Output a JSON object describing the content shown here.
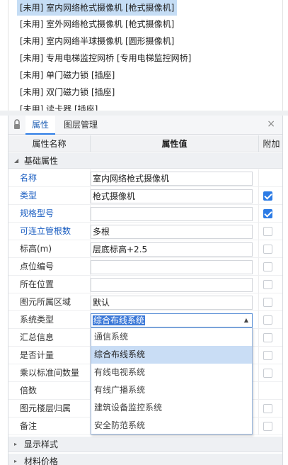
{
  "device_list": {
    "items": [
      {
        "label": "[未用] 室内网络枪式摄像机 [枪式摄像机]",
        "selected": true
      },
      {
        "label": "[未用] 室外网络枪式摄像机 [枪式摄像机]",
        "selected": false
      },
      {
        "label": "[未用] 室内网络半球摄像机 [圆形摄像机]",
        "selected": false
      },
      {
        "label": "[未用] 专用电梯监控网桥 [专用电梯监控网桥]",
        "selected": false
      },
      {
        "label": "[未用] 单门磁力锁 [插座]",
        "selected": false
      },
      {
        "label": "[未用] 双门磁力锁 [插座]",
        "selected": false
      },
      {
        "label": "[未用] 读卡器 [插座]",
        "selected": false
      }
    ]
  },
  "panel": {
    "tabs": [
      {
        "label": "属性",
        "active": true
      },
      {
        "label": "图层管理",
        "active": false
      }
    ],
    "close_symbol": "×",
    "columns": {
      "name": "属性名称",
      "value": "属性值",
      "extra": "附加"
    },
    "groups": {
      "basic": "基础属性",
      "display": "显示样式",
      "material": "材料价格"
    },
    "rows": [
      {
        "name": "名称",
        "value": "室内网络枪式摄像机",
        "blue": true,
        "checkbox": false,
        "has_checkbox": false
      },
      {
        "name": "类型",
        "value": "枪式摄像机",
        "blue": true,
        "checkbox": true,
        "has_checkbox": true
      },
      {
        "name": "规格型号",
        "value": "",
        "blue": true,
        "checkbox": true,
        "has_checkbox": true
      },
      {
        "name": "可连立管根数",
        "value": "多根",
        "blue": true,
        "checkbox": false,
        "has_checkbox": true
      },
      {
        "name": "标高(m)",
        "value": "层底标高+2.5",
        "blue": false,
        "checkbox": false,
        "has_checkbox": true
      },
      {
        "name": "点位编号",
        "value": "",
        "blue": false,
        "checkbox": false,
        "has_checkbox": true
      },
      {
        "name": "所在位置",
        "value": "",
        "blue": false,
        "checkbox": false,
        "has_checkbox": true
      },
      {
        "name": "图元所属区域",
        "value": "默认",
        "blue": false,
        "checkbox": false,
        "has_checkbox": true
      },
      {
        "name": "系统类型",
        "value": "综合布线系统",
        "blue": false,
        "checkbox": false,
        "has_checkbox": true
      },
      {
        "name": "汇总信息",
        "value": "",
        "blue": false,
        "checkbox": false,
        "has_checkbox": true
      },
      {
        "name": "是否计量",
        "value": "",
        "blue": false,
        "checkbox": false,
        "has_checkbox": true
      },
      {
        "name": "乘以标准间数量",
        "value": "",
        "blue": false,
        "checkbox": false,
        "has_checkbox": true
      },
      {
        "name": "倍数",
        "value": "",
        "blue": false,
        "checkbox": false,
        "has_checkbox": false
      },
      {
        "name": "图元楼层归属",
        "value": "",
        "blue": false,
        "checkbox": false,
        "has_checkbox": true
      },
      {
        "name": "备注",
        "value": "",
        "blue": false,
        "checkbox": false,
        "has_checkbox": true
      }
    ],
    "system_type_dropdown": {
      "selected": "综合布线系统",
      "options": [
        "通信系统",
        "综合布线系统",
        "有线电视系统",
        "有线广播系统",
        "建筑设备监控系统",
        "安全防范系统"
      ]
    }
  },
  "colors": {
    "accent": "#2c7be5",
    "selection": "#c5ddf5",
    "label_blue": "#1c5fc2"
  }
}
